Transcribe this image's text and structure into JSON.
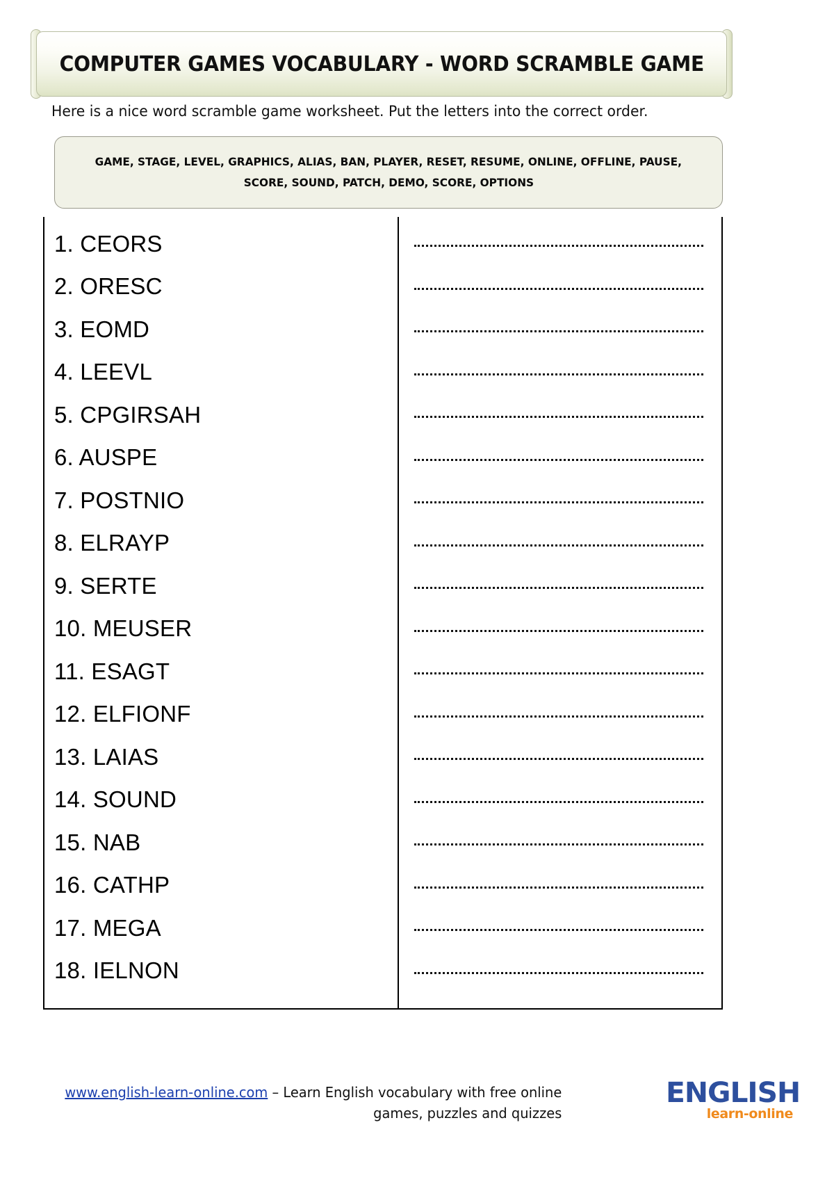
{
  "header": {
    "title": "COMPUTER GAMES VOCABULARY - WORD SCRAMBLE GAME"
  },
  "intro": {
    "text": "Here is a nice word scramble game worksheet. Put the letters into the correct order."
  },
  "word_bank": {
    "line1": "GAME, STAGE, LEVEL, GRAPHICS, ALIAS, BAN, PLAYER, RESET, RESUME, ONLINE, OFFLINE, PAUSE,",
    "line2": "SCORE, SOUND, PATCH, DEMO, SCORE, OPTIONS",
    "words": [
      "GAME",
      "STAGE",
      "LEVEL",
      "GRAPHICS",
      "ALIAS",
      "BAN",
      "PLAYER",
      "RESET",
      "RESUME",
      "ONLINE",
      "OFFLINE",
      "PAUSE",
      "SCORE",
      "SOUND",
      "PATCH",
      "DEMO",
      "SCORE",
      "OPTIONS"
    ]
  },
  "items": [
    {
      "number": "1.",
      "scramble": "CEORS",
      "text": "1. CEORS"
    },
    {
      "number": "2.",
      "scramble": "ORESC",
      "text": "2. ORESC"
    },
    {
      "number": "3.",
      "scramble": "EOMD",
      "text": "3. EOMD"
    },
    {
      "number": "4.",
      "scramble": "LEEVL",
      "text": "4. LEEVL"
    },
    {
      "number": "5.",
      "scramble": "CPGIRSAH",
      "text": "5. CPGIRSAH"
    },
    {
      "number": "6.",
      "scramble": "AUSPE",
      "text": "6. AUSPE"
    },
    {
      "number": "7.",
      "scramble": "POSTNIO",
      "text": "7. POSTNIO"
    },
    {
      "number": "8.",
      "scramble": "ELRAYP",
      "text": "8. ELRAYP"
    },
    {
      "number": "9.",
      "scramble": "SERTE",
      "text": "9. SERTE"
    },
    {
      "number": "10.",
      "scramble": "MEUSER",
      "text": "10. MEUSER"
    },
    {
      "number": "11.",
      "scramble": "ESAGT",
      "text": "11. ESAGT"
    },
    {
      "number": "12.",
      "scramble": "ELFIONF",
      "text": "12. ELFIONF"
    },
    {
      "number": "13.",
      "scramble": "LAIAS",
      "text": "13. LAIAS"
    },
    {
      "number": "14.",
      "scramble": "SOUND",
      "text": "14. SOUND"
    },
    {
      "number": "15.",
      "scramble": "NAB",
      "text": "15. NAB"
    },
    {
      "number": "16.",
      "scramble": "CATHP",
      "text": "16. CATHP"
    },
    {
      "number": "17.",
      "scramble": "MEGA",
      "text": "17. MEGA"
    },
    {
      "number": "18.",
      "scramble": "IELNON",
      "text": "18. IELNON"
    }
  ],
  "answers": {
    "blank_line": "..............................."
  },
  "footer": {
    "url": "www.english-learn-online.com",
    "tagline": " – Learn English vocabulary with free online games, puzzles and quizzes",
    "logo_main": "ENGLISH",
    "logo_sub": "learn-online"
  },
  "colors": {
    "banner_green": "#e3e8cd",
    "wordbank_bg": "#f1f2e7",
    "link_blue": "#1b3fae",
    "logo_blue": "#2d4f9e",
    "logo_orange": "#f08a1c"
  }
}
